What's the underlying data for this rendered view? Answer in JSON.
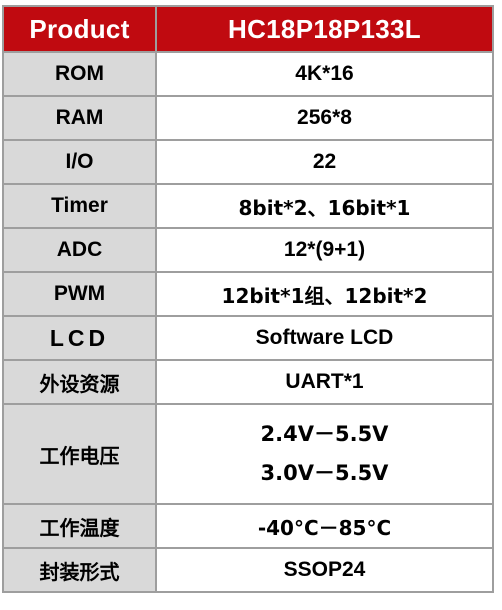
{
  "table": {
    "header": {
      "label": "Product",
      "value": "HC18P18P133L",
      "bg_color": "#C00A10",
      "text_color": "#FFFFFF"
    },
    "colors": {
      "label_bg": "#D9D9D9",
      "value_bg": "#FFFFFF",
      "border": "#9E9E9E",
      "text": "#000000"
    },
    "rows": [
      {
        "label": "ROM",
        "value": "4K*16"
      },
      {
        "label": "RAM",
        "value": "256*8"
      },
      {
        "label": "I/O",
        "value": "22"
      },
      {
        "label": "Timer",
        "value": "8bit*2、16bit*1"
      },
      {
        "label": "ADC",
        "value": "12*(9+1)"
      },
      {
        "label": "PWM",
        "value": "12bit*1组、12bit*2"
      },
      {
        "label": "LCD",
        "value": "Software LCD"
      },
      {
        "label": "外设资源",
        "value": "UART*1"
      },
      {
        "label": "工作电压",
        "value_line1": "2.4V－5.5V",
        "value_line2": "3.0V－5.5V"
      },
      {
        "label": "工作温度",
        "value": "-40°C－85°C"
      },
      {
        "label": "封装形式",
        "value": "SSOP24"
      }
    ]
  }
}
